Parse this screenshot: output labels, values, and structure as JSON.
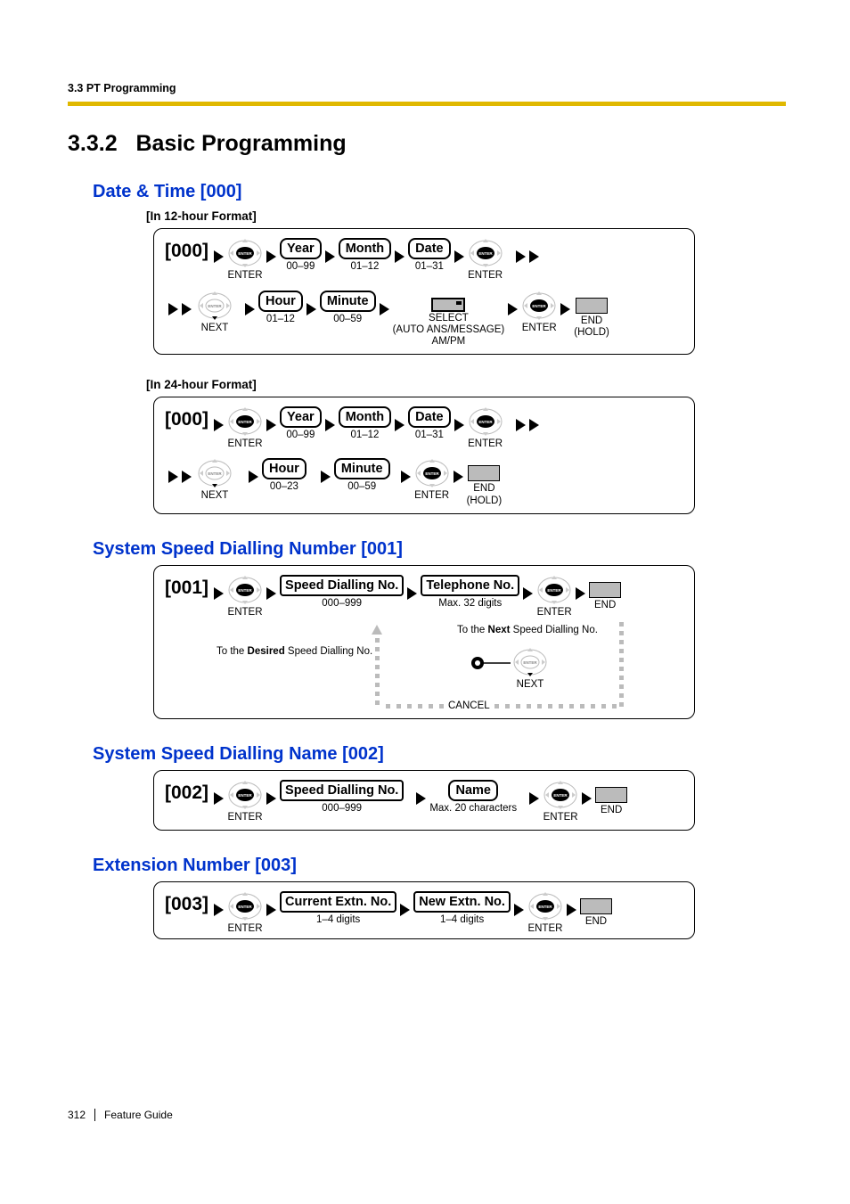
{
  "header": {
    "breadcrumb": "3.3 PT Programming"
  },
  "section": {
    "number": "3.3.2",
    "title": "Basic Programming"
  },
  "s000": {
    "heading": "Date & Time [000]",
    "fmt12": "[In 12-hour Format]",
    "fmt24": "[In 24-hour Format]",
    "code": "[000]",
    "enter": "ENTER",
    "next": "NEXT",
    "year": "Year",
    "year_r": "00–99",
    "month": "Month",
    "month_r": "01–12",
    "date": "Date",
    "date_r": "01–31",
    "hour12": "Hour",
    "hour12_r": "01–12",
    "hour24": "Hour",
    "hour24_r": "00–23",
    "minute": "Minute",
    "minute_r": "00–59",
    "select": "SELECT",
    "select_sub1": "(AUTO ANS/MESSAGE)",
    "select_sub2": "AM/PM",
    "end": "END",
    "hold": "(HOLD)"
  },
  "s001": {
    "heading": "System Speed Dialling Number [001]",
    "code": "[001]",
    "enter": "ENTER",
    "sdn": "Speed Dialling No.",
    "sdn_r": "000–999",
    "tel": "Telephone No.",
    "tel_r": "Max. 32 digits",
    "end": "END",
    "next": "NEXT",
    "cancel": "CANCEL",
    "note_desired_pre": "To the ",
    "note_desired_b": "Desired",
    "note_desired_post": " Speed Dialling No.",
    "note_next_pre": "To the ",
    "note_next_b": "Next",
    "note_next_post": " Speed Dialling No."
  },
  "s002": {
    "heading": "System Speed Dialling Name [002]",
    "code": "[002]",
    "enter": "ENTER",
    "sdn": "Speed Dialling No.",
    "sdn_r": "000–999",
    "name": "Name",
    "name_r": "Max. 20 characters",
    "end": "END"
  },
  "s003": {
    "heading": "Extension Number [003]",
    "code": "[003]",
    "enter": "ENTER",
    "cur": "Current Extn. No.",
    "cur_r": "1–4 digits",
    "new": "New Extn. No.",
    "new_r": "1–4 digits",
    "end": "END"
  },
  "footer": {
    "page": "312",
    "doc": "Feature Guide"
  }
}
